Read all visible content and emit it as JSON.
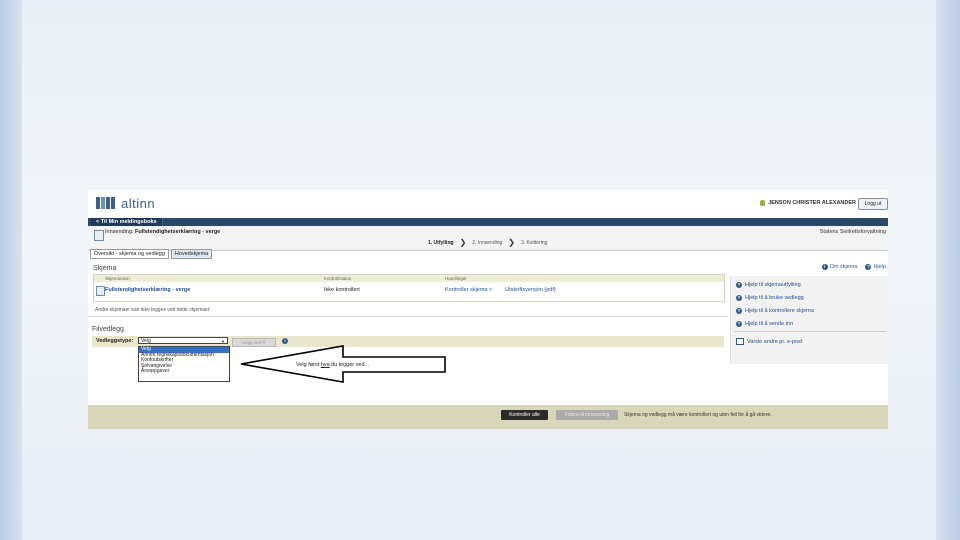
{
  "header": {
    "logo_text": "altinn",
    "user_name": "JENSON CHRISTER ALEXANDER",
    "logout": "Logg ut"
  },
  "nav": {
    "back": "< Til Min meldingsboks"
  },
  "submission": {
    "prefix": "Innsending: ",
    "title": "Fullstendighetserklæring - verge",
    "agency": "Statens Sivilrettsforvaltning",
    "steps": [
      "1. Utfylling",
      "2. Innsending",
      "3. Kvittering"
    ]
  },
  "tabs": [
    "Oversikt - skjema og vedlegg",
    "Hovedskjema"
  ],
  "skjema": {
    "title": "Skjema",
    "columns": [
      "Skjemanavn",
      "Kontrollstatus",
      "Handlinger"
    ],
    "row": {
      "name": "Fullstendighetserklæring - verge",
      "status": "Ikke kontrollert",
      "action1": "Kontroller skjema >",
      "action2": "Utskriftsversjon (pdf)"
    },
    "note": "Andre skjemaer kan ikke legges ved dette skjemaet."
  },
  "filvedlegg": {
    "title": "Filvedlegg",
    "label": "Vedleggstype:",
    "selected": "Velg",
    "add_button": "Legg ved fil",
    "options": [
      "Velg",
      "Annen regnskapsdokumentasjon",
      "Kontoutskrifter",
      "Selvangivelse",
      "Årsoppgaver"
    ]
  },
  "callout": {
    "pre": "Velg først ",
    "u": "hva",
    "post": " du legger ved..."
  },
  "sidebar": {
    "top_links": [
      "Om skjema",
      "Hjelp"
    ],
    "items": [
      "Hjelp til skjemautfylling",
      "Hjelp til å bruke vedlegg",
      "Hjelp til å kontrollere skjema",
      "Hjelp til å sende inn"
    ],
    "email": "Varsle andre pr. e-post"
  },
  "footer": {
    "check_all": "Kontroller alle",
    "next": "Videre til innsending",
    "text": "Skjema og vedlegg må være kontrollert og uten feil for å gå videre."
  }
}
